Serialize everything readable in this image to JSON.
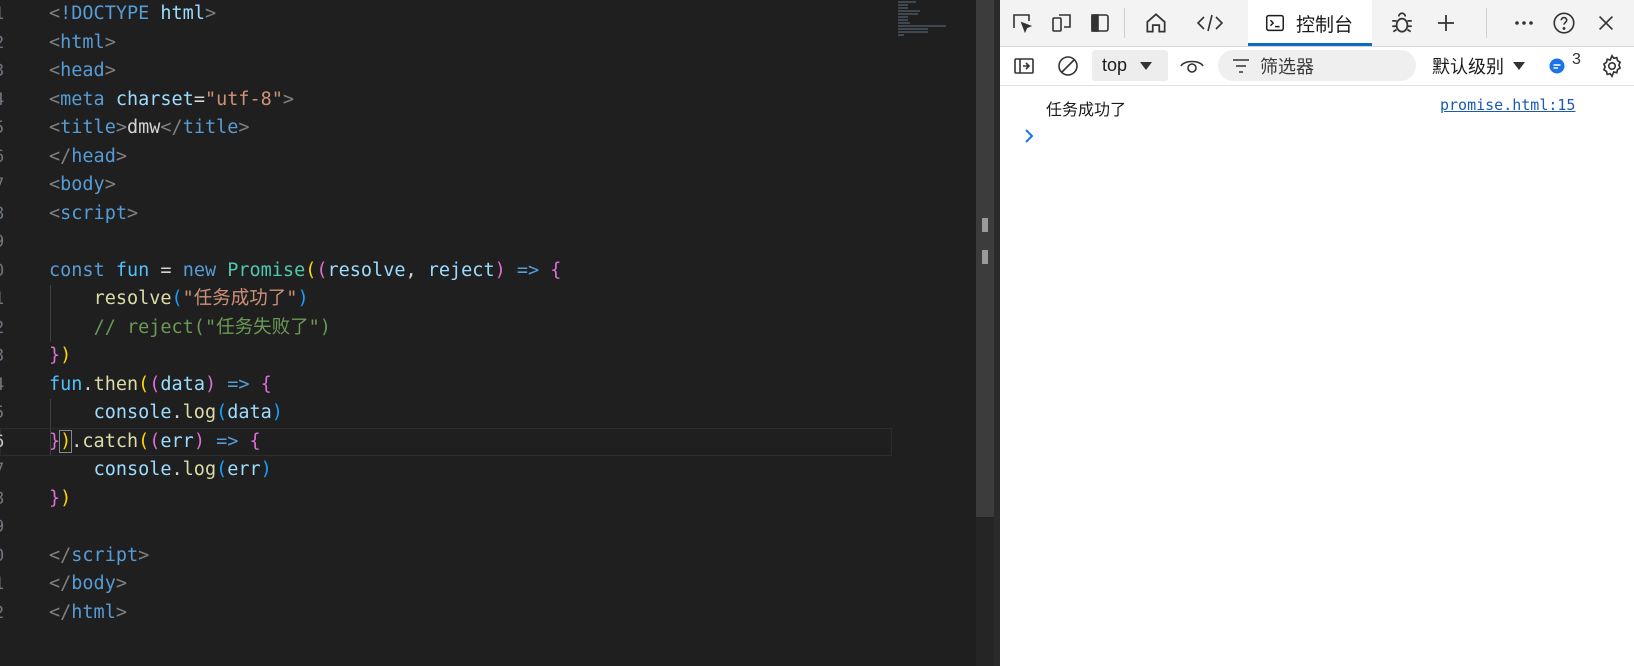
{
  "editor": {
    "line_numbers": [
      "1",
      "2",
      "3",
      "4",
      "5",
      "6",
      "7",
      "8",
      "9",
      "0",
      "1",
      "2",
      "3",
      "4",
      "5",
      "6",
      "7",
      "8",
      "9",
      "0",
      "1",
      "2"
    ],
    "current_line_index": 15,
    "code": {
      "l1": {
        "a": "<",
        "b": "!DOCTYPE",
        "c": " html",
        "d": ">"
      },
      "l2": {
        "a": "<",
        "b": "html",
        "c": ">"
      },
      "l3": {
        "a": "<",
        "b": "head",
        "c": ">"
      },
      "l4": {
        "a": "<",
        "b": "meta",
        "c": " charset",
        "d": "=",
        "e": "\"utf-8\"",
        "f": ">"
      },
      "l5": {
        "a": "<",
        "b": "title",
        "c": ">",
        "d": "dmw",
        "e": "</",
        "f": "title",
        "g": ">"
      },
      "l6": {
        "a": "</",
        "b": "head",
        "c": ">"
      },
      "l7": {
        "a": "<",
        "b": "body",
        "c": ">"
      },
      "l8": {
        "a": "<",
        "b": "script",
        "c": ">"
      },
      "l10": {
        "a": "const",
        "b": " fun",
        "c": " = ",
        "d": "new",
        "e": " Promise",
        "f": "(",
        "g": "(",
        "h": "resolve",
        "i": ", ",
        "j": "reject",
        "k": ")",
        "l": " => ",
        "m": "{"
      },
      "l11": {
        "a": "    ",
        "b": "resolve",
        "c": "(",
        "d": "\"任务成功了\"",
        "e": ")"
      },
      "l12": {
        "a": "    ",
        "b": "// reject(\"任务失败了\")"
      },
      "l13": {
        "a": "}",
        "b": ")"
      },
      "l14": {
        "a": "fun",
        "b": ".",
        "c": "then",
        "d": "(",
        "e": "(",
        "f": "data",
        "g": ")",
        "h": " => ",
        "i": "{"
      },
      "l15": {
        "a": "    ",
        "b": "console",
        "c": ".",
        "d": "log",
        "e": "(",
        "f": "data",
        "g": ")"
      },
      "l16": {
        "a": "}",
        "b": ")",
        "c": ".",
        "d": "catch",
        "e": "(",
        "f": "(",
        "g": "err",
        "h": ")",
        "i": " => ",
        "j": "{"
      },
      "l17": {
        "a": "    ",
        "b": "console",
        "c": ".",
        "d": "log",
        "e": "(",
        "f": "err",
        "g": ")"
      },
      "l18": {
        "a": "}",
        "b": ")"
      },
      "l20": {
        "a": "</",
        "b": "script",
        "c": ">"
      },
      "l21": {
        "a": "</",
        "b": "body",
        "c": ">"
      },
      "l22": {
        "a": "</",
        "b": "html",
        "c": ">"
      }
    }
  },
  "devtools": {
    "toolbar": {
      "console_tab_label": "控制台",
      "icons": [
        "inspect-icon",
        "device-emulation-icon",
        "dock-icon",
        "welcome-home-icon",
        "elements-icon",
        "console-icon",
        "debugger-bug-icon",
        "add-tab-icon",
        "more-icon",
        "help-icon",
        "close-icon"
      ]
    },
    "filterbar": {
      "context_value": "top",
      "filter_placeholder": "筛选器",
      "level_value": "默认级别",
      "issues_count": "3"
    },
    "console": {
      "messages": [
        {
          "text": "任务成功了",
          "source": "promise.html:15"
        }
      ]
    },
    "colors": {
      "accent": "#0f6cbd",
      "link": "#1a5ab6"
    }
  }
}
